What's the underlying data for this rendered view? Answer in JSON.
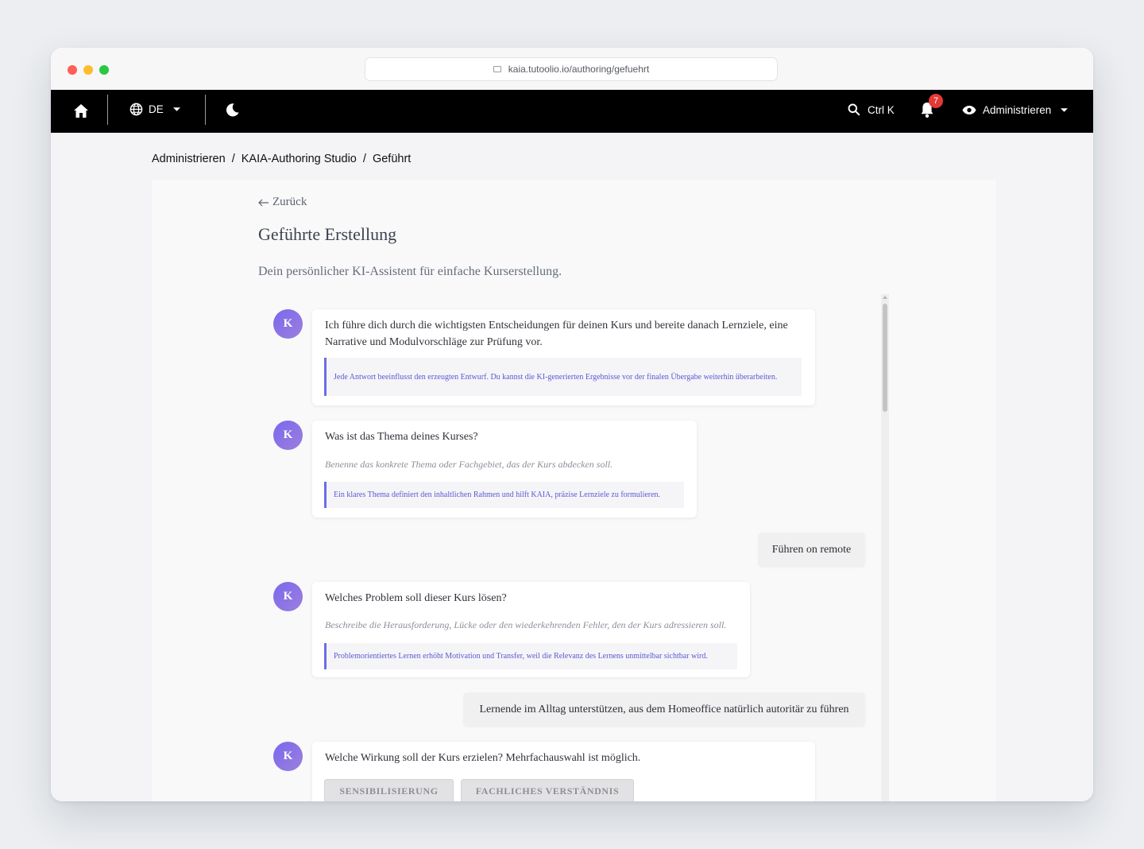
{
  "browser": {
    "url": "kaia.tutoolio.io/authoring/gefuehrt"
  },
  "topnav": {
    "language": "DE",
    "search_shortcut": "Ctrl K",
    "notification_count": "7",
    "user_menu_label": "Administrieren"
  },
  "breadcrumb": {
    "items": [
      "Administrieren",
      "KAIA-Authoring Studio",
      "Geführt"
    ],
    "separator": "/"
  },
  "page": {
    "back_label": "Zurück",
    "title": "Geführte Erstellung",
    "subtitle": "Dein persönlicher KI-Assistent für einfache Kurserstellung."
  },
  "chat": {
    "avatar_letter": "K",
    "messages": [
      {
        "text": "Ich führe dich durch die wichtigsten Entscheidungen für deinen Kurs und bereite danach Lernziele, eine Narrative und Modulvorschläge zur Prüfung vor.",
        "note": "Jede Antwort beeinflusst den erzeugten Entwurf. Du kannst die KI-generierten Ergebnisse vor der finalen Übergabe weiterhin überarbeiten."
      },
      {
        "question": "Was ist das Thema deines Kurses?",
        "hint": "Benenne das konkrete Thema oder Fachgebiet, das der Kurs abdecken soll.",
        "note": "Ein klares Thema definiert den inhaltlichen Rahmen und hilft KAIA, präzise Lernziele zu formulieren."
      },
      {
        "reply": "Führen on remote"
      },
      {
        "question": "Welches Problem soll dieser Kurs lösen?",
        "hint": "Beschreibe die Herausforderung, Lücke oder den wiederkehrenden Fehler, den der Kurs adressieren soll.",
        "note": "Problemorientiertes Lernen erhöht Motivation und Transfer, weil die Relevanz des Lernens unmittelbar sichtbar wird."
      },
      {
        "reply": "Lernende im Alltag unterstützen, aus dem Homeoffice natürlich autoritär zu führen"
      },
      {
        "question": "Welche Wirkung soll der Kurs erzielen? Mehrfachauswahl ist möglich.",
        "options": [
          "SENSIBILISIERUNG",
          "FACHLICHES VERSTÄNDNIS"
        ]
      }
    ]
  },
  "colors": {
    "nav_background": "#000000",
    "accent": "#6d6ce8",
    "avatar": "#8b6fe6",
    "badge": "#e53935"
  },
  "icons": [
    "home-icon",
    "globe-icon",
    "caret-down-icon",
    "moon-icon",
    "search-icon",
    "bell-icon",
    "eye-icon",
    "arrow-left-icon"
  ]
}
